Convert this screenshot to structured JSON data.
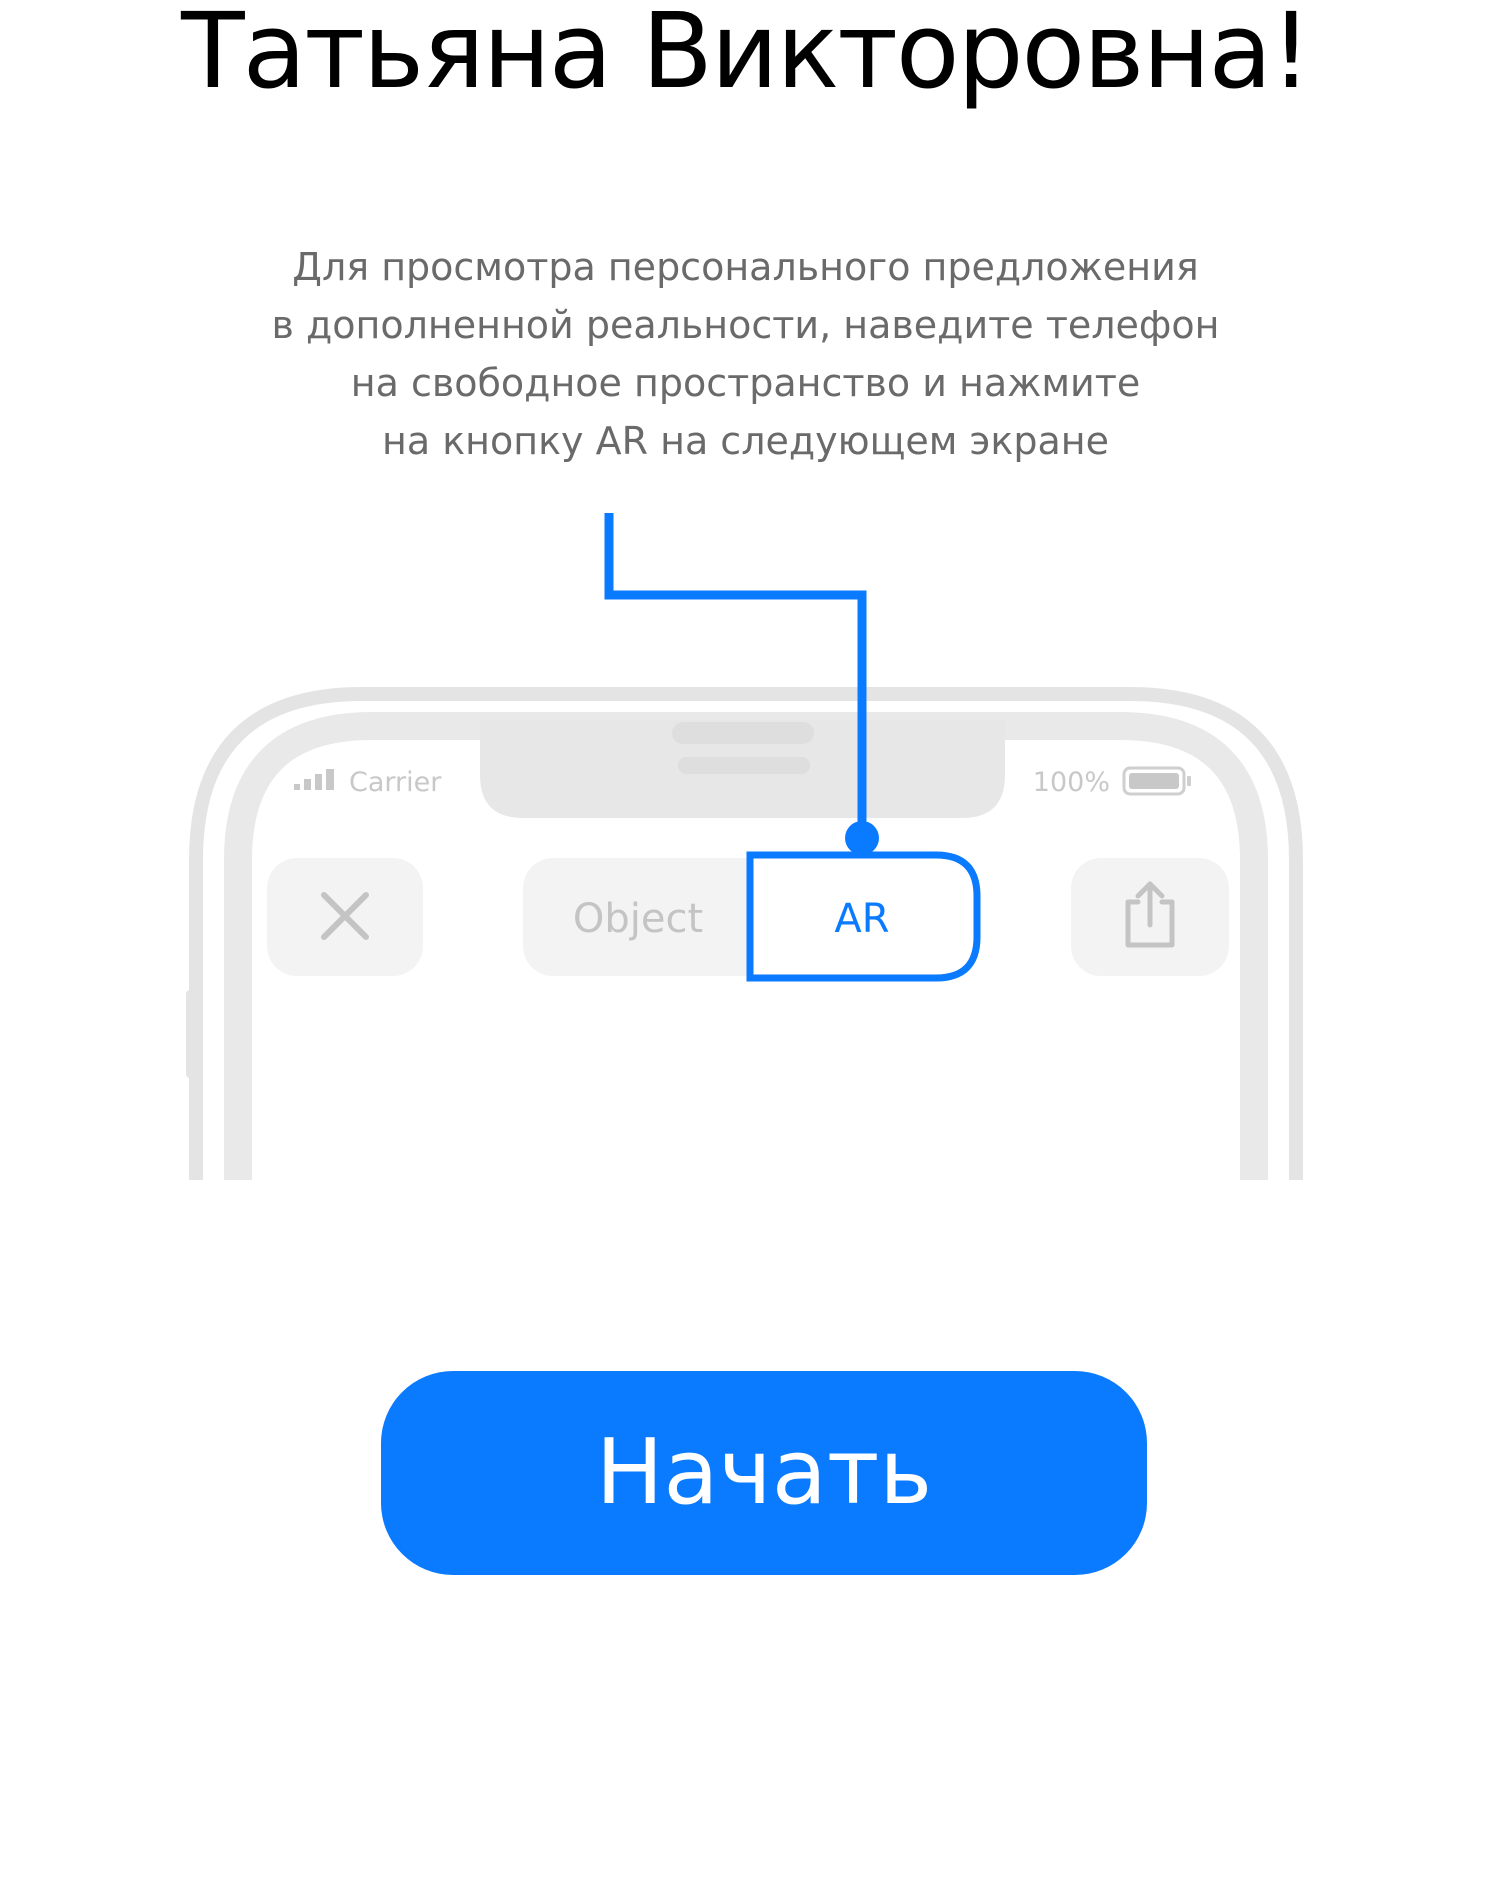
{
  "greeting": {
    "name": "Татьяна Викторовна!"
  },
  "instruction": {
    "lines": [
      "Для просмотра персонального предложения",
      "в дополненной реальности, наведите телефон",
      "на свободное пространство и нажмите",
      "на кнопку AR на следующем экране"
    ]
  },
  "phone": {
    "status_bar": {
      "carrier": "Carrier",
      "battery_percent": "100%"
    },
    "toolbar": {
      "close_icon": "close-icon",
      "segment_object": "Object",
      "segment_ar": "AR",
      "share_icon": "share-icon"
    }
  },
  "start_button": {
    "label": "Начать"
  },
  "colors": {
    "accent": "#0a7aff",
    "text_primary": "#000000",
    "text_secondary": "#6a6a6a",
    "phone_frame": "#e4e4e4",
    "faded_control": "#f3f3f3",
    "faded_text": "#c4c4c4"
  }
}
